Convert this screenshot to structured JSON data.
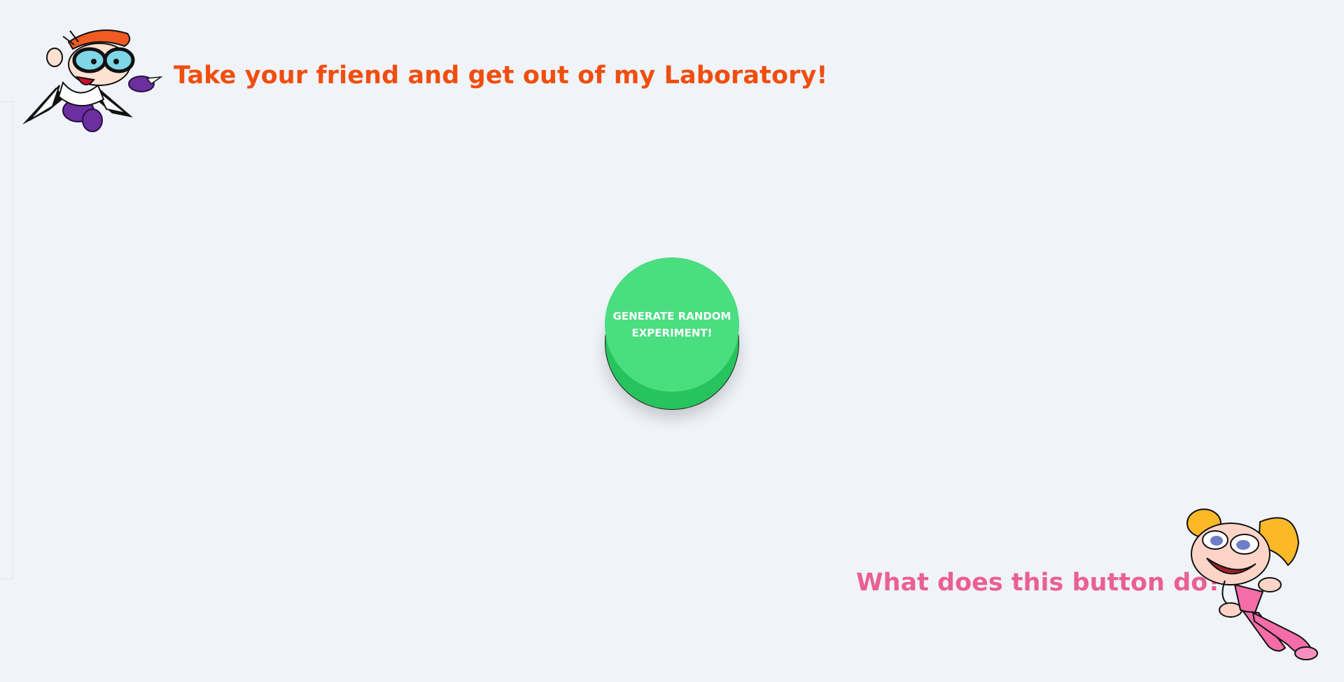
{
  "header": {
    "caption": "Take your friend and get out of my Laboratory!",
    "character_icon": "dexter-character-icon",
    "caption_color": "#f04e0f"
  },
  "main": {
    "button_label": "GENERATE RANDOM EXPERIMENT!",
    "button_color": "#4ade80",
    "button_shadow_color": "#27c35c"
  },
  "footer": {
    "caption": "What does this button do?",
    "character_icon": "deedee-character-icon",
    "caption_color": "#ea5f96"
  },
  "page": {
    "background": "#f0f4f9"
  }
}
